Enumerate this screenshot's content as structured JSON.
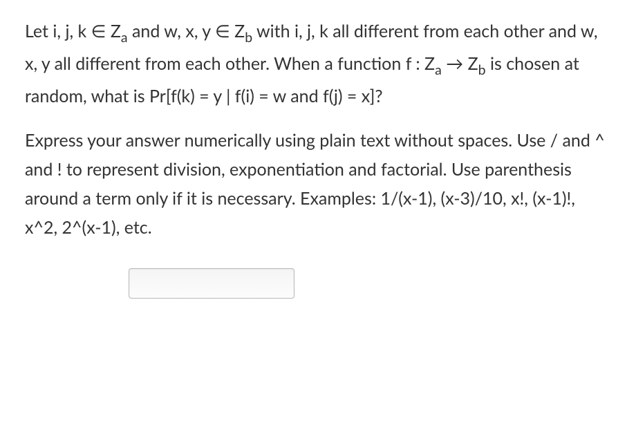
{
  "question": {
    "part1": "Let i, j, k ∈ Z",
    "sub_a": "a",
    "part2": " and w, x, y ∈ Z",
    "sub_b": "b",
    "part3": " with i, j, k all different from each other and w, x, y all different from each other. When a function f : Z",
    "sub_a2": "a",
    "part4": " → Z",
    "sub_b2": "b",
    "part5": " is chosen at random, what is Pr[f(k) = y | f(i) = w and f(j) = x]?"
  },
  "instructions": "Express your answer numerically using plain text without spaces. Use / and ^ and ! to represent division, exponentiation and factorial. Use parenthesis around a term only if it is necessary. Examples: 1/(x-1), (x-3)/10, x!, (x-1)!, x^2, 2^(x-1), etc.",
  "answer": {
    "value": "",
    "placeholder": ""
  }
}
